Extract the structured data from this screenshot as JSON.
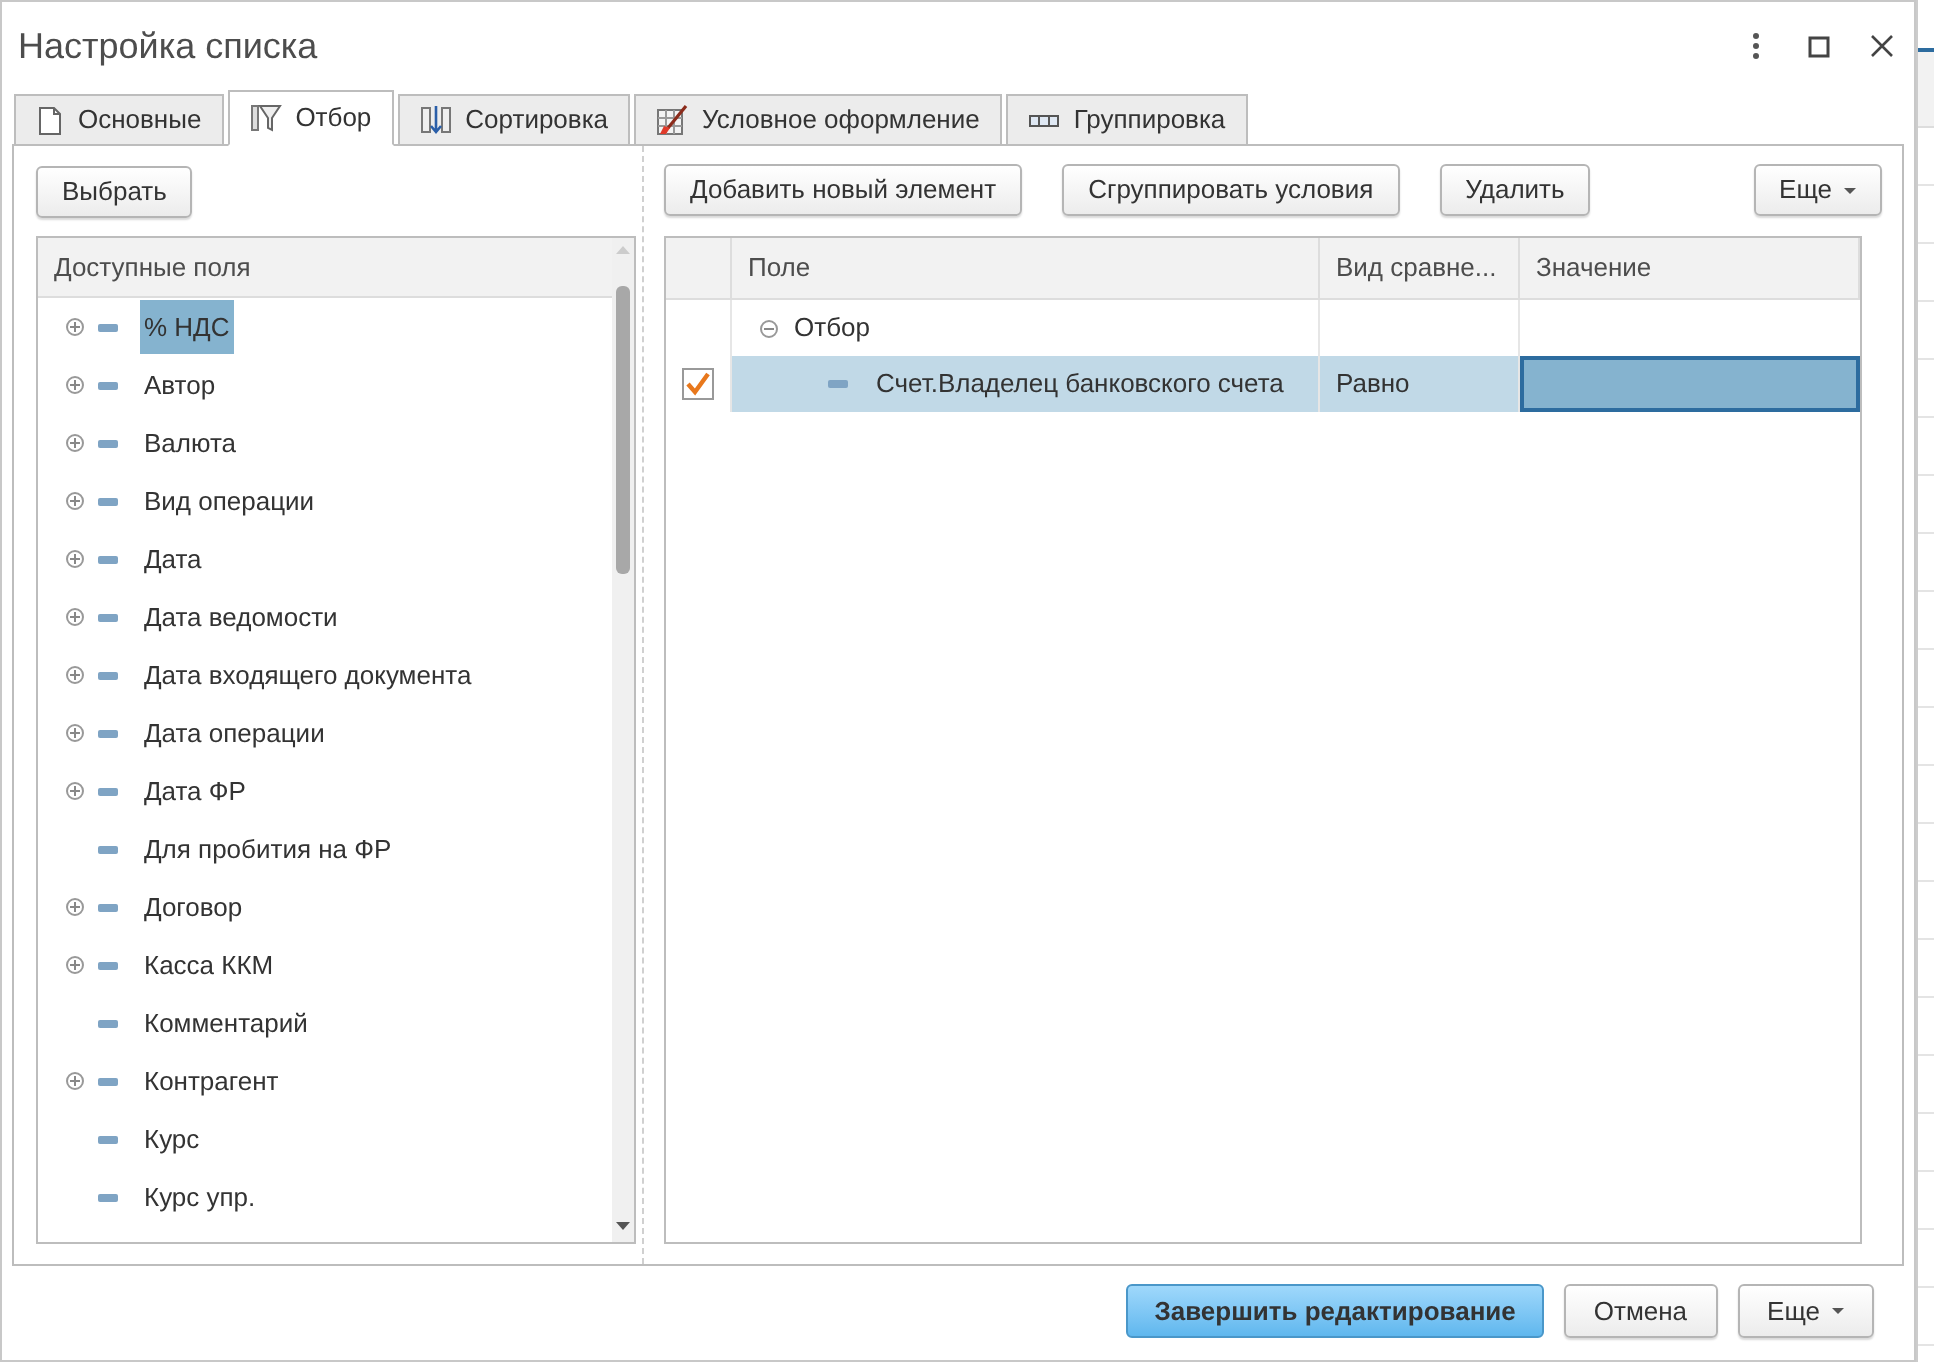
{
  "window": {
    "title": "Настройка списка"
  },
  "tabs": [
    {
      "label": "Основные",
      "selected": false,
      "kind": "page"
    },
    {
      "label": "Отбор",
      "selected": true,
      "kind": "filter"
    },
    {
      "label": "Сортировка",
      "selected": false,
      "kind": "sort"
    },
    {
      "label": "Условное оформление",
      "selected": false,
      "kind": "style"
    },
    {
      "label": "Группировка",
      "selected": false,
      "kind": "group"
    }
  ],
  "left_panel": {
    "button": "Выбрать",
    "tree_header": "Доступные поля",
    "fields": [
      {
        "label": "% НДС",
        "expandable": true,
        "selected": true
      },
      {
        "label": "Автор",
        "expandable": true,
        "selected": false
      },
      {
        "label": "Валюта",
        "expandable": true,
        "selected": false
      },
      {
        "label": "Вид операции",
        "expandable": true,
        "selected": false
      },
      {
        "label": "Дата",
        "expandable": true,
        "selected": false
      },
      {
        "label": "Дата ведомости",
        "expandable": true,
        "selected": false
      },
      {
        "label": "Дата входящего документа",
        "expandable": true,
        "selected": false
      },
      {
        "label": "Дата операции",
        "expandable": true,
        "selected": false
      },
      {
        "label": "Дата ФР",
        "expandable": true,
        "selected": false
      },
      {
        "label": "Для пробития на ФР",
        "expandable": false,
        "selected": false
      },
      {
        "label": "Договор",
        "expandable": true,
        "selected": false
      },
      {
        "label": "Касса ККМ",
        "expandable": true,
        "selected": false
      },
      {
        "label": "Комментарий",
        "expandable": false,
        "selected": false
      },
      {
        "label": "Контрагент",
        "expandable": true,
        "selected": false
      },
      {
        "label": "Курс",
        "expandable": false,
        "selected": false
      },
      {
        "label": "Курс упр.",
        "expandable": false,
        "selected": false
      }
    ]
  },
  "right_panel": {
    "buttons": [
      "Добавить новый элемент",
      "Сгруппировать условия",
      "Удалить"
    ],
    "more_button": "Еще",
    "columns": [
      "Поле",
      "Вид сравне...",
      "Значение"
    ],
    "rows": [
      {
        "field": "Отбор",
        "expanded": true,
        "selected": false,
        "children": [
          {
            "field": "Счет.Владелец банковского счета",
            "comparison": "Равно",
            "checked": true,
            "selected": true
          }
        ]
      }
    ]
  },
  "footer": {
    "buttons": [
      {
        "label": "Завершить редактирование",
        "primary": true
      },
      {
        "label": "Отмена",
        "primary": false
      },
      {
        "label": "Еще",
        "primary": false,
        "dropdown": true
      }
    ]
  }
}
